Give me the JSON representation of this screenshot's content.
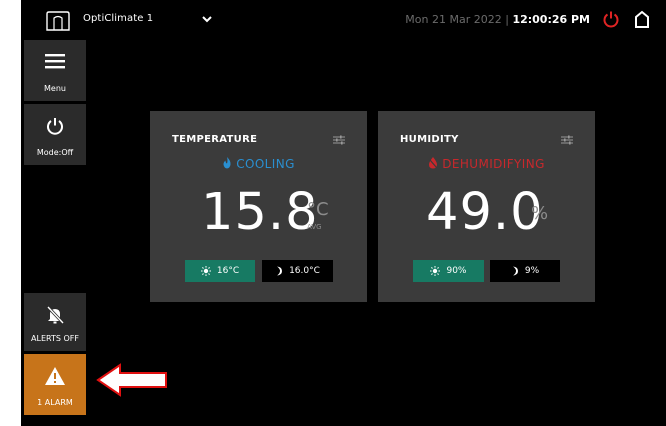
{
  "header": {
    "device_name": "OptiClimate 1",
    "date": "Mon 21 Mar 2022 |",
    "time": "12:00:26 PM"
  },
  "sidebar": {
    "menu_label": "Menu",
    "mode_label": "Mode:Off",
    "alerts_label": "ALERTS OFF",
    "alarm_label": "1 ALARM"
  },
  "temperature": {
    "title": "TEMPERATURE",
    "status": "COOLING",
    "value": "15.8",
    "unit": "°C",
    "avg_label": "AVG",
    "day_setpoint": "16°C",
    "night_setpoint": "16.0°C"
  },
  "humidity": {
    "title": "HUMIDITY",
    "status": "DEHUMIDIFYING",
    "value": "49.0",
    "unit": "%",
    "day_setpoint": "90%",
    "night_setpoint": "9%"
  },
  "colors": {
    "alarm": "#c7741a",
    "cooling": "#2a8fd0",
    "dehumidifying": "#c8282c",
    "day_pill": "#177a63",
    "power": "#e02424",
    "arrow": "#e01010"
  },
  "icons": {
    "header": [
      "logo-icon",
      "chevron-down-icon",
      "power-icon",
      "home-icon"
    ],
    "sidebar": [
      "hamburger-icon",
      "power-icon",
      "bell-off-icon",
      "warning-icon"
    ]
  }
}
